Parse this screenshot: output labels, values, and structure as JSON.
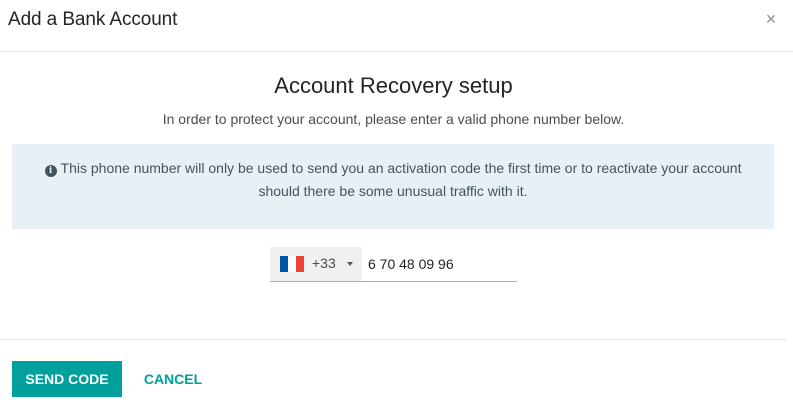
{
  "dialog": {
    "title": "Add a Bank Account",
    "close_glyph": "×"
  },
  "recovery": {
    "heading": "Account Recovery setup",
    "subtitle": "In order to protect your account, please enter a valid phone number below.",
    "info_icon": "info-circle-icon",
    "info_glyph": "i",
    "info_text": "This phone number will only be used to send you an activation code the first time or to reactivate your account should there be some unusual traffic with it."
  },
  "phone": {
    "country": "France",
    "flag_colors": [
      "#0055a4",
      "#ffffff",
      "#ef4135"
    ],
    "dial_code": "+33",
    "number": "6 70 48 09 96"
  },
  "footer": {
    "send_code_label": "SEND CODE",
    "cancel_label": "CANCEL"
  },
  "colors": {
    "accent": "#00a09d",
    "info_background": "#e6f0f5"
  }
}
